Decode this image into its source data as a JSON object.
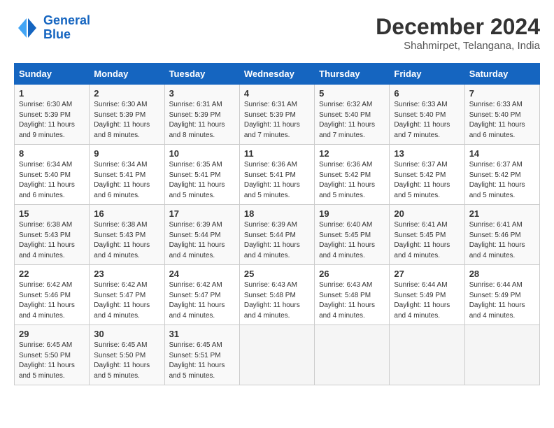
{
  "header": {
    "logo_line1": "General",
    "logo_line2": "Blue",
    "month": "December 2024",
    "location": "Shahmirpet, Telangana, India"
  },
  "days_of_week": [
    "Sunday",
    "Monday",
    "Tuesday",
    "Wednesday",
    "Thursday",
    "Friday",
    "Saturday"
  ],
  "weeks": [
    [
      {
        "day": "1",
        "sunrise": "6:30 AM",
        "sunset": "5:39 PM",
        "daylight": "11 hours and 9 minutes."
      },
      {
        "day": "2",
        "sunrise": "6:30 AM",
        "sunset": "5:39 PM",
        "daylight": "11 hours and 8 minutes."
      },
      {
        "day": "3",
        "sunrise": "6:31 AM",
        "sunset": "5:39 PM",
        "daylight": "11 hours and 8 minutes."
      },
      {
        "day": "4",
        "sunrise": "6:31 AM",
        "sunset": "5:39 PM",
        "daylight": "11 hours and 7 minutes."
      },
      {
        "day": "5",
        "sunrise": "6:32 AM",
        "sunset": "5:40 PM",
        "daylight": "11 hours and 7 minutes."
      },
      {
        "day": "6",
        "sunrise": "6:33 AM",
        "sunset": "5:40 PM",
        "daylight": "11 hours and 7 minutes."
      },
      {
        "day": "7",
        "sunrise": "6:33 AM",
        "sunset": "5:40 PM",
        "daylight": "11 hours and 6 minutes."
      }
    ],
    [
      {
        "day": "8",
        "sunrise": "6:34 AM",
        "sunset": "5:40 PM",
        "daylight": "11 hours and 6 minutes."
      },
      {
        "day": "9",
        "sunrise": "6:34 AM",
        "sunset": "5:41 PM",
        "daylight": "11 hours and 6 minutes."
      },
      {
        "day": "10",
        "sunrise": "6:35 AM",
        "sunset": "5:41 PM",
        "daylight": "11 hours and 5 minutes."
      },
      {
        "day": "11",
        "sunrise": "6:36 AM",
        "sunset": "5:41 PM",
        "daylight": "11 hours and 5 minutes."
      },
      {
        "day": "12",
        "sunrise": "6:36 AM",
        "sunset": "5:42 PM",
        "daylight": "11 hours and 5 minutes."
      },
      {
        "day": "13",
        "sunrise": "6:37 AM",
        "sunset": "5:42 PM",
        "daylight": "11 hours and 5 minutes."
      },
      {
        "day": "14",
        "sunrise": "6:37 AM",
        "sunset": "5:42 PM",
        "daylight": "11 hours and 5 minutes."
      }
    ],
    [
      {
        "day": "15",
        "sunrise": "6:38 AM",
        "sunset": "5:43 PM",
        "daylight": "11 hours and 4 minutes."
      },
      {
        "day": "16",
        "sunrise": "6:38 AM",
        "sunset": "5:43 PM",
        "daylight": "11 hours and 4 minutes."
      },
      {
        "day": "17",
        "sunrise": "6:39 AM",
        "sunset": "5:44 PM",
        "daylight": "11 hours and 4 minutes."
      },
      {
        "day": "18",
        "sunrise": "6:39 AM",
        "sunset": "5:44 PM",
        "daylight": "11 hours and 4 minutes."
      },
      {
        "day": "19",
        "sunrise": "6:40 AM",
        "sunset": "5:45 PM",
        "daylight": "11 hours and 4 minutes."
      },
      {
        "day": "20",
        "sunrise": "6:41 AM",
        "sunset": "5:45 PM",
        "daylight": "11 hours and 4 minutes."
      },
      {
        "day": "21",
        "sunrise": "6:41 AM",
        "sunset": "5:46 PM",
        "daylight": "11 hours and 4 minutes."
      }
    ],
    [
      {
        "day": "22",
        "sunrise": "6:42 AM",
        "sunset": "5:46 PM",
        "daylight": "11 hours and 4 minutes."
      },
      {
        "day": "23",
        "sunrise": "6:42 AM",
        "sunset": "5:47 PM",
        "daylight": "11 hours and 4 minutes."
      },
      {
        "day": "24",
        "sunrise": "6:42 AM",
        "sunset": "5:47 PM",
        "daylight": "11 hours and 4 minutes."
      },
      {
        "day": "25",
        "sunrise": "6:43 AM",
        "sunset": "5:48 PM",
        "daylight": "11 hours and 4 minutes."
      },
      {
        "day": "26",
        "sunrise": "6:43 AM",
        "sunset": "5:48 PM",
        "daylight": "11 hours and 4 minutes."
      },
      {
        "day": "27",
        "sunrise": "6:44 AM",
        "sunset": "5:49 PM",
        "daylight": "11 hours and 4 minutes."
      },
      {
        "day": "28",
        "sunrise": "6:44 AM",
        "sunset": "5:49 PM",
        "daylight": "11 hours and 4 minutes."
      }
    ],
    [
      {
        "day": "29",
        "sunrise": "6:45 AM",
        "sunset": "5:50 PM",
        "daylight": "11 hours and 5 minutes."
      },
      {
        "day": "30",
        "sunrise": "6:45 AM",
        "sunset": "5:50 PM",
        "daylight": "11 hours and 5 minutes."
      },
      {
        "day": "31",
        "sunrise": "6:45 AM",
        "sunset": "5:51 PM",
        "daylight": "11 hours and 5 minutes."
      },
      null,
      null,
      null,
      null
    ]
  ]
}
